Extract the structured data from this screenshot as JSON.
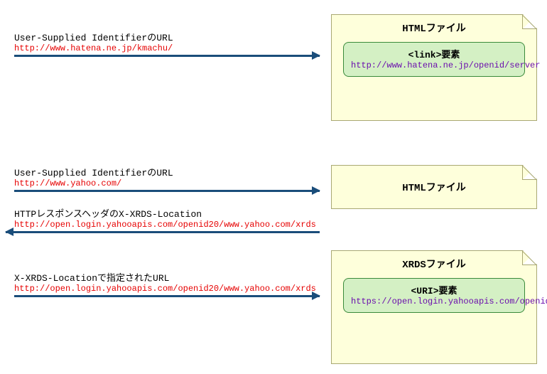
{
  "arrows": {
    "a1": {
      "label": "User-Supplied IdentifierのURL",
      "url": "http://www.hatena.ne.jp/kmachu/"
    },
    "a2": {
      "label": "User-Supplied IdentifierのURL",
      "url": "http://www.yahoo.com/"
    },
    "a3": {
      "label": "HTTPレスポンスヘッダのX-XRDS-Location",
      "url": "http://open.login.yahooapis.com/openid20/www.yahoo.com/xrds"
    },
    "a4": {
      "label": "X-XRDS-Locationで指定されたURL",
      "url": "http://open.login.yahooapis.com/openid20/www.yahoo.com/xrds"
    }
  },
  "files": {
    "f1": {
      "title": "HTMLファイル",
      "element": "<link>要素",
      "url": "http://www.hatena.ne.jp/openid/server"
    },
    "f2": {
      "title": "HTMLファイル"
    },
    "f3": {
      "title": "XRDSファイル",
      "element": "<URI>要素",
      "url": "https://open.login.yahooapis.com/openid/op/auth"
    }
  }
}
